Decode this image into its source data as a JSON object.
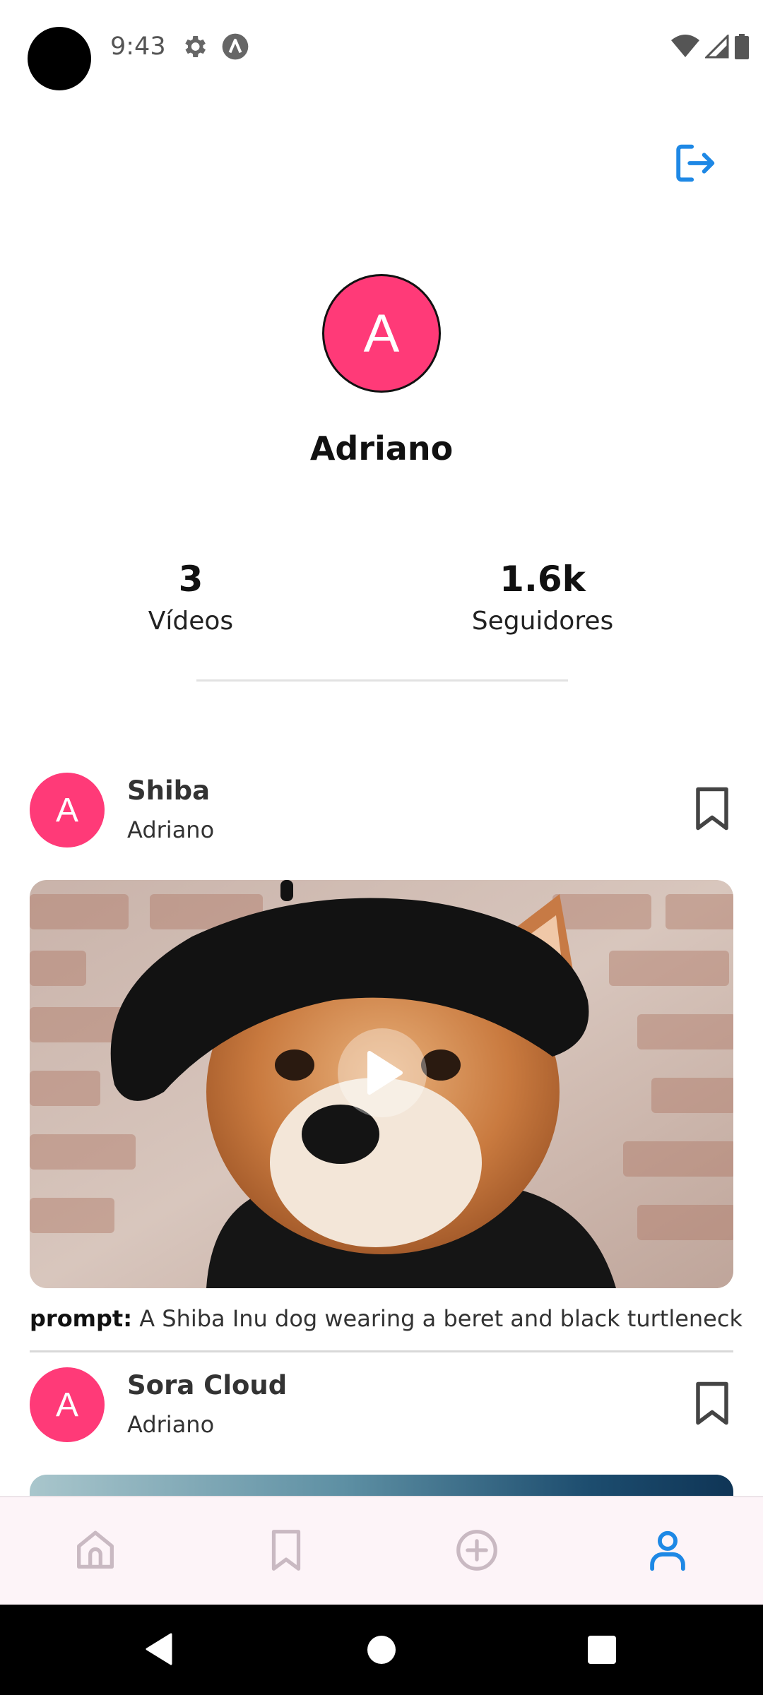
{
  "status_bar": {
    "time": "9:43"
  },
  "profile": {
    "avatar_letter": "A",
    "name": "Adriano",
    "stats": [
      {
        "value": "3",
        "label": "Vídeos"
      },
      {
        "value": "1.6k",
        "label": "Seguidores"
      }
    ]
  },
  "posts": [
    {
      "avatar_letter": "A",
      "title": "Shiba",
      "author": "Adriano",
      "prompt_label": "prompt:",
      "prompt_text": "A Shiba Inu dog wearing a beret and black turtleneck"
    },
    {
      "avatar_letter": "A",
      "title": "Sora Cloud",
      "author": "Adriano"
    }
  ],
  "bottom_nav": [
    "home-icon",
    "bookmark-icon",
    "plus-circle-icon",
    "user-icon"
  ],
  "colors": {
    "accent": "#1e88e5",
    "avatar": "#ff3a78",
    "nav_inactive": "#c9b9c2"
  }
}
